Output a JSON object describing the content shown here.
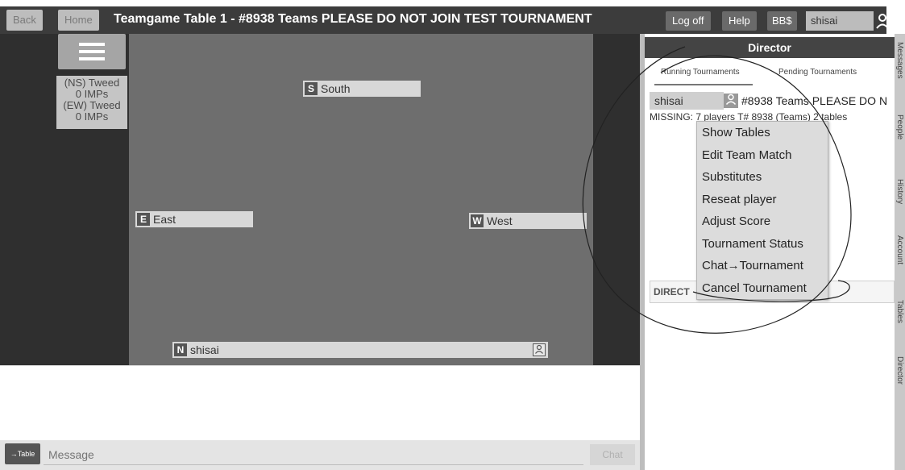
{
  "topbar": {
    "back_label": "Back",
    "home_label": "Home",
    "title": "Teamgame Table 1 - #8938 Teams PLEASE DO NOT JOIN TEST TOURNAMENT",
    "logoff_label": "Log off",
    "help_label": "Help",
    "bbs_label": "BB$",
    "username": "shisai"
  },
  "score": {
    "ns_label": "(NS) Tweed",
    "ns_imps": "0 IMPs",
    "ew_label": "(EW) Tweed",
    "ew_imps": "0 IMPs"
  },
  "seats": {
    "south": {
      "dir": "S",
      "name": "South"
    },
    "east": {
      "dir": "E",
      "name": "East"
    },
    "west": {
      "dir": "W",
      "name": "West"
    },
    "north": {
      "dir": "N",
      "name": "shisai"
    }
  },
  "chat": {
    "table_button": "→Table",
    "message_placeholder": "Message",
    "send_label": "Chat"
  },
  "director": {
    "header": "Director",
    "tab_running": "Running Tournaments",
    "tab_pending": "Pending Tournaments",
    "row_user": "shisai",
    "row_name": "#8938 Teams PLEASE DO N",
    "missing_text": "MISSING: 7 players T# 8938 (Teams) 2 tables",
    "director_label": "DIRECT"
  },
  "context_menu": {
    "items": [
      "Show Tables",
      "Edit Team Match",
      "Substitutes",
      "Reseat player",
      "Adjust Score",
      "Tournament Status",
      "Chat→Tournament",
      "Cancel Tournament"
    ]
  },
  "side_tabs": [
    "Messages",
    "People",
    "History",
    "Account",
    "Tables",
    "Director"
  ]
}
